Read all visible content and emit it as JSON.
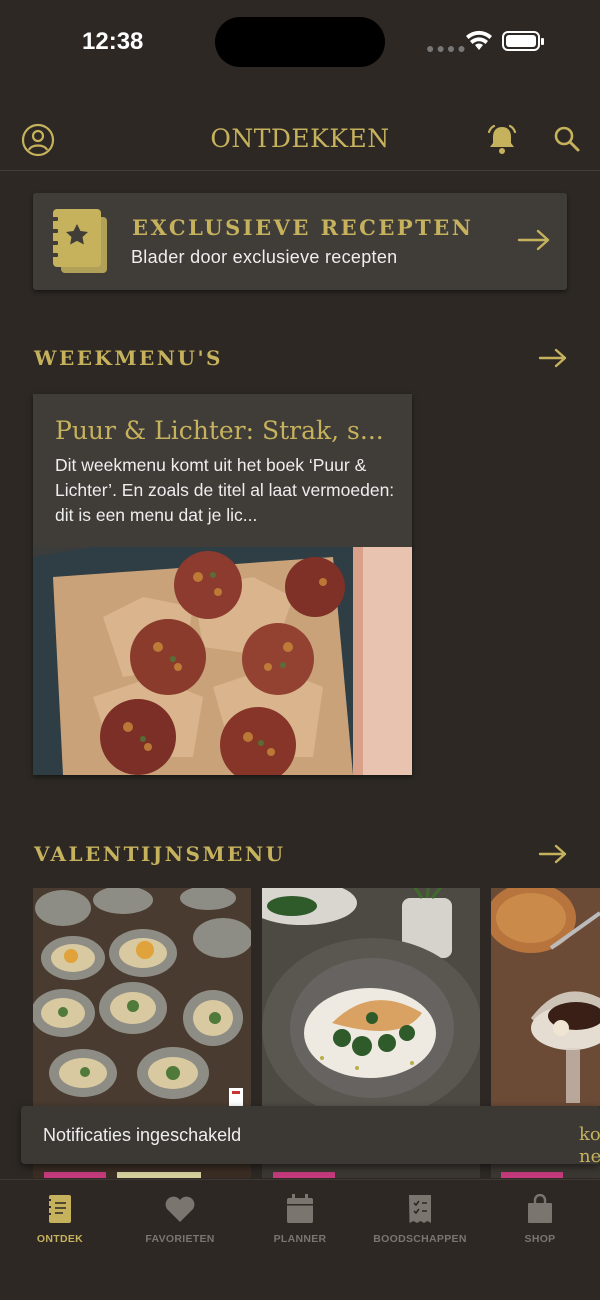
{
  "status_bar": {
    "time": "12:38"
  },
  "header": {
    "title": "ONTDEKKEN"
  },
  "banner": {
    "title": "EXCLUSIEVE RECEPTEN",
    "subtitle": "Blader door exclusieve recepten"
  },
  "weekmenus": {
    "title": "WEEKMENU'S",
    "card": {
      "title": "Puur & Lichter: Strak, s...",
      "description": "Dit weekmenu komt uit het boek ‘Puur & Lichter’. En zoals de titel al laat vermoeden: dit is een menu dat je lic..."
    }
  },
  "valentijn": {
    "title": "VALENTIJNSMENU",
    "peek_text": [
      "ko",
      "ne"
    ]
  },
  "snackbar": {
    "text": "Notificaties ingeschakeld"
  },
  "tabbar": {
    "items": [
      {
        "label": "ONTDEK",
        "icon": "book-icon",
        "active": true
      },
      {
        "label": "FAVORIETEN",
        "icon": "heart-icon",
        "active": false
      },
      {
        "label": "PLANNER",
        "icon": "calendar-icon",
        "active": false
      },
      {
        "label": "BOODSCHAPPEN",
        "icon": "receipt-icon",
        "active": false
      },
      {
        "label": "SHOP",
        "icon": "bag-icon",
        "active": false
      }
    ]
  },
  "colors": {
    "background": "#2d2824",
    "accent": "#c6b25d",
    "card": "#403c38",
    "tag_pink": "#c43a7c",
    "tag_beige": "#d6cf9c"
  }
}
